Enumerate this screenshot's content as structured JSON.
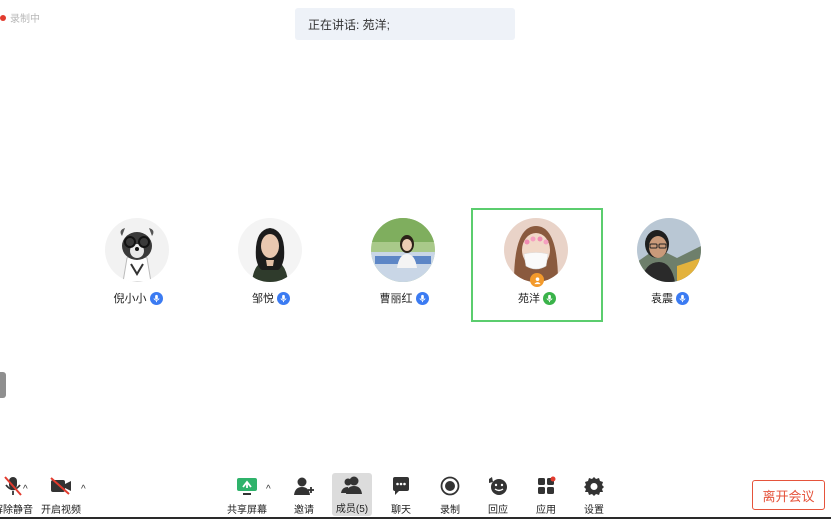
{
  "recording": {
    "label": "录制中",
    "dot_color": "#e23b2e"
  },
  "speaking": {
    "text": "正在讲话: 苑洋;"
  },
  "participants": [
    {
      "name": "倪小小",
      "mic": "mic-icon",
      "mic_color": "#3b7bf2"
    },
    {
      "name": "邹悦",
      "mic": "mic-icon",
      "mic_color": "#3b7bf2"
    },
    {
      "name": "曹丽红",
      "mic": "mic-icon",
      "mic_color": "#3b7bf2"
    },
    {
      "name": "苑洋",
      "mic": "mic-active-icon",
      "mic_color": "#3ab34a",
      "active": true,
      "host": true
    },
    {
      "name": "袁震",
      "mic": "mic-icon",
      "mic_color": "#3b7bf2"
    }
  ],
  "toolbar": {
    "unmute": "解除静音",
    "start_video": "开启视频",
    "share_screen": "共享屏幕",
    "invite": "邀请",
    "members": "成员(5)",
    "chat": "聊天",
    "record": "录制",
    "reactions": "回应",
    "apps": "应用",
    "settings": "设置",
    "leave": "离开会议"
  },
  "colors": {
    "accent": "#3b7bf2",
    "active_border": "#5bcd6e",
    "leave": "#e5533b",
    "share_green": "#2fb36b"
  }
}
